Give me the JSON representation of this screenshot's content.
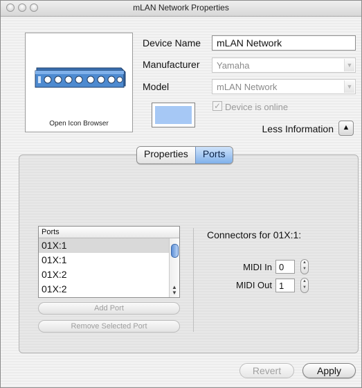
{
  "window": {
    "title": "mLAN Network Properties"
  },
  "icon_panel": {
    "caption": "Open Icon Browser"
  },
  "device": {
    "name_label": "Device Name",
    "name_value": "mLAN Network",
    "manufacturer_label": "Manufacturer",
    "manufacturer_value": "Yamaha",
    "model_label": "Model",
    "model_value": "mLAN Network",
    "online_label": "Device is online",
    "color_swatch": "#a6c8f5",
    "less_info_label": "Less Information"
  },
  "tabs": [
    {
      "label": "Properties",
      "active": false
    },
    {
      "label": "Ports",
      "active": true
    }
  ],
  "ports": {
    "header": "Ports",
    "items": [
      "01X:1",
      "01X:1",
      "01X:2",
      "01X:2"
    ],
    "selected_index": 0,
    "add_label": "Add Port",
    "remove_label": "Remove Selected Port"
  },
  "connectors": {
    "title": "Connectors for 01X:1:",
    "midi_in_label": "MIDI In",
    "midi_in_value": "0",
    "midi_out_label": "MIDI Out",
    "midi_out_value": "1"
  },
  "buttons": {
    "revert_label": "Revert",
    "apply_label": "Apply"
  },
  "colors": {
    "accent": "#7fb0ea",
    "scroll_thumb": "#5c8fd6"
  }
}
